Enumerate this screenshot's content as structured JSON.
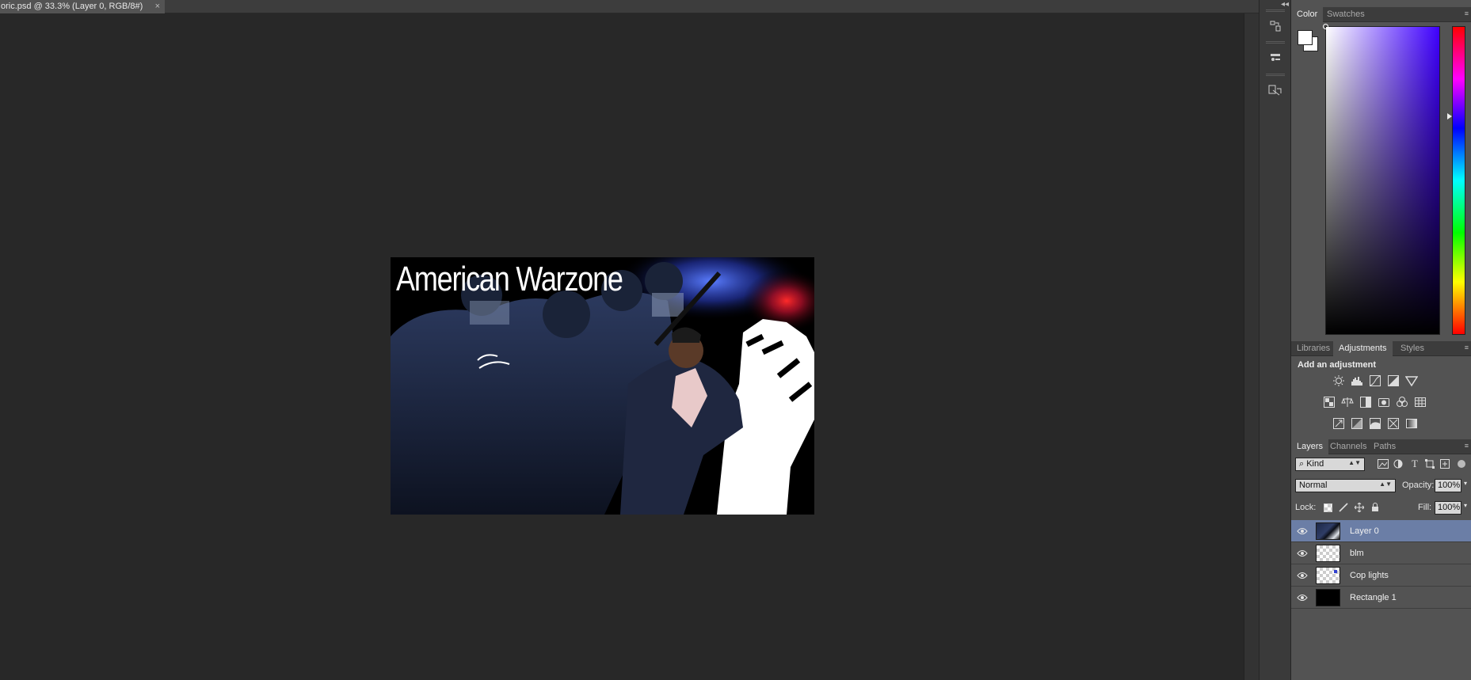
{
  "document": {
    "tab_title": "oric.psd @ 33.3% (Layer 0, RGB/8#)",
    "close_glyph": "×",
    "artwork_text": "American Warzone"
  },
  "dock": {
    "collapse_glyph": "◂◂",
    "buttons": [
      "history-icon",
      "properties-icon",
      "character-icon"
    ]
  },
  "color_panel": {
    "tabs": [
      "Color",
      "Swatches"
    ],
    "active_tab": "Color",
    "foreground": "#ffffff",
    "background": "#ffffff",
    "hue_color": "#3f00ff"
  },
  "adjustments_panel": {
    "tabs": [
      "Libraries",
      "Adjustments",
      "Styles"
    ],
    "active_tab": "Adjustments",
    "heading": "Add an adjustment",
    "row1": [
      "brightness-contrast-icon",
      "levels-icon",
      "curves-icon",
      "exposure-icon",
      "gradient-triangle-icon"
    ],
    "row2": [
      "vibrance-icon",
      "color-balance-icon",
      "black-white-icon",
      "photo-filter-icon",
      "channel-mixer-icon",
      "color-lookup-icon"
    ],
    "row3": [
      "invert-icon",
      "posterize-icon",
      "threshold-icon",
      "selective-color-icon",
      "gradient-map-icon"
    ]
  },
  "layers_panel": {
    "tabs": [
      "Layers",
      "Channels",
      "Paths"
    ],
    "active_tab": "Layers",
    "filter_kind": "Kind",
    "blend_mode": "Normal",
    "opacity_label": "Opacity:",
    "opacity_value": "100%",
    "lock_label": "Lock:",
    "fill_label": "Fill:",
    "fill_value": "100%",
    "layers": [
      {
        "name": "Layer 0",
        "visible": true,
        "selected": true,
        "thumb": "photo"
      },
      {
        "name": "blm",
        "visible": true,
        "selected": false,
        "thumb": "transparent"
      },
      {
        "name": "Cop lights",
        "visible": true,
        "selected": false,
        "thumb": "transparent"
      },
      {
        "name": "Rectangle 1",
        "visible": true,
        "selected": false,
        "thumb": "black"
      }
    ]
  }
}
